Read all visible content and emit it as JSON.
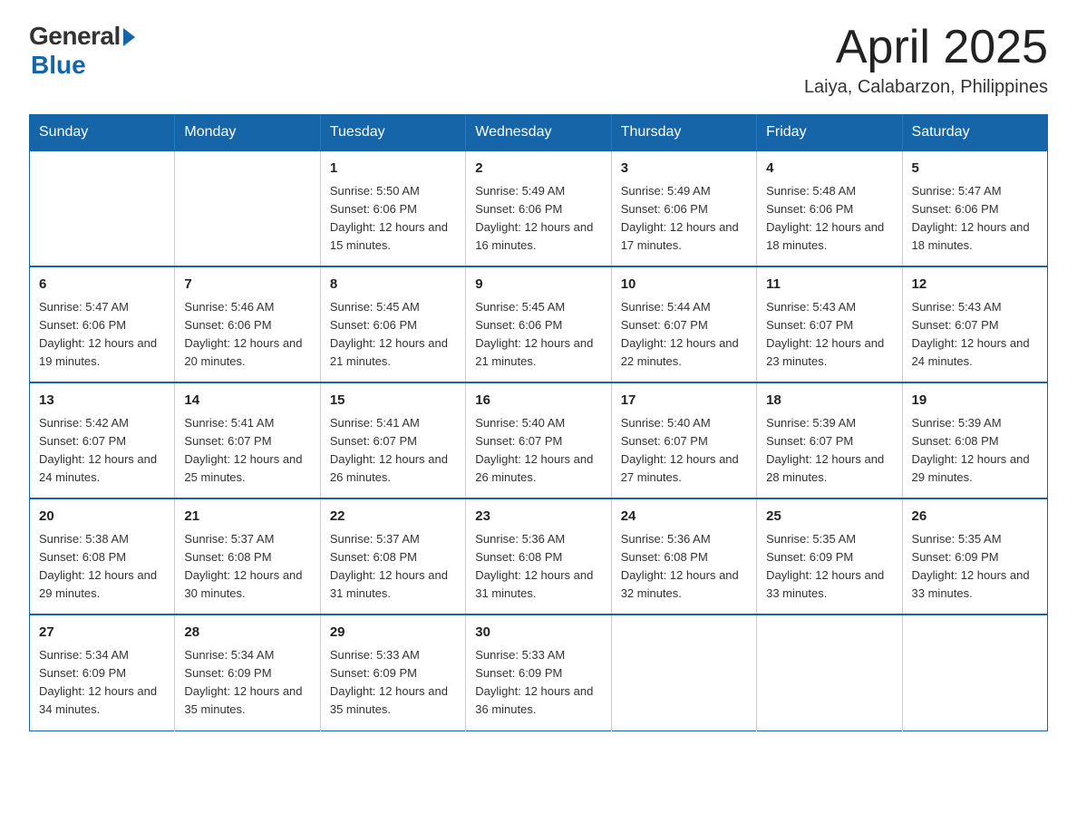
{
  "header": {
    "logo_general": "General",
    "logo_blue": "Blue",
    "month_title": "April 2025",
    "location": "Laiya, Calabarzon, Philippines"
  },
  "calendar": {
    "days_of_week": [
      "Sunday",
      "Monday",
      "Tuesday",
      "Wednesday",
      "Thursday",
      "Friday",
      "Saturday"
    ],
    "weeks": [
      [
        {
          "day": "",
          "info": ""
        },
        {
          "day": "",
          "info": ""
        },
        {
          "day": "1",
          "info": "Sunrise: 5:50 AM\nSunset: 6:06 PM\nDaylight: 12 hours\nand 15 minutes."
        },
        {
          "day": "2",
          "info": "Sunrise: 5:49 AM\nSunset: 6:06 PM\nDaylight: 12 hours\nand 16 minutes."
        },
        {
          "day": "3",
          "info": "Sunrise: 5:49 AM\nSunset: 6:06 PM\nDaylight: 12 hours\nand 17 minutes."
        },
        {
          "day": "4",
          "info": "Sunrise: 5:48 AM\nSunset: 6:06 PM\nDaylight: 12 hours\nand 18 minutes."
        },
        {
          "day": "5",
          "info": "Sunrise: 5:47 AM\nSunset: 6:06 PM\nDaylight: 12 hours\nand 18 minutes."
        }
      ],
      [
        {
          "day": "6",
          "info": "Sunrise: 5:47 AM\nSunset: 6:06 PM\nDaylight: 12 hours\nand 19 minutes."
        },
        {
          "day": "7",
          "info": "Sunrise: 5:46 AM\nSunset: 6:06 PM\nDaylight: 12 hours\nand 20 minutes."
        },
        {
          "day": "8",
          "info": "Sunrise: 5:45 AM\nSunset: 6:06 PM\nDaylight: 12 hours\nand 21 minutes."
        },
        {
          "day": "9",
          "info": "Sunrise: 5:45 AM\nSunset: 6:06 PM\nDaylight: 12 hours\nand 21 minutes."
        },
        {
          "day": "10",
          "info": "Sunrise: 5:44 AM\nSunset: 6:07 PM\nDaylight: 12 hours\nand 22 minutes."
        },
        {
          "day": "11",
          "info": "Sunrise: 5:43 AM\nSunset: 6:07 PM\nDaylight: 12 hours\nand 23 minutes."
        },
        {
          "day": "12",
          "info": "Sunrise: 5:43 AM\nSunset: 6:07 PM\nDaylight: 12 hours\nand 24 minutes."
        }
      ],
      [
        {
          "day": "13",
          "info": "Sunrise: 5:42 AM\nSunset: 6:07 PM\nDaylight: 12 hours\nand 24 minutes."
        },
        {
          "day": "14",
          "info": "Sunrise: 5:41 AM\nSunset: 6:07 PM\nDaylight: 12 hours\nand 25 minutes."
        },
        {
          "day": "15",
          "info": "Sunrise: 5:41 AM\nSunset: 6:07 PM\nDaylight: 12 hours\nand 26 minutes."
        },
        {
          "day": "16",
          "info": "Sunrise: 5:40 AM\nSunset: 6:07 PM\nDaylight: 12 hours\nand 26 minutes."
        },
        {
          "day": "17",
          "info": "Sunrise: 5:40 AM\nSunset: 6:07 PM\nDaylight: 12 hours\nand 27 minutes."
        },
        {
          "day": "18",
          "info": "Sunrise: 5:39 AM\nSunset: 6:07 PM\nDaylight: 12 hours\nand 28 minutes."
        },
        {
          "day": "19",
          "info": "Sunrise: 5:39 AM\nSunset: 6:08 PM\nDaylight: 12 hours\nand 29 minutes."
        }
      ],
      [
        {
          "day": "20",
          "info": "Sunrise: 5:38 AM\nSunset: 6:08 PM\nDaylight: 12 hours\nand 29 minutes."
        },
        {
          "day": "21",
          "info": "Sunrise: 5:37 AM\nSunset: 6:08 PM\nDaylight: 12 hours\nand 30 minutes."
        },
        {
          "day": "22",
          "info": "Sunrise: 5:37 AM\nSunset: 6:08 PM\nDaylight: 12 hours\nand 31 minutes."
        },
        {
          "day": "23",
          "info": "Sunrise: 5:36 AM\nSunset: 6:08 PM\nDaylight: 12 hours\nand 31 minutes."
        },
        {
          "day": "24",
          "info": "Sunrise: 5:36 AM\nSunset: 6:08 PM\nDaylight: 12 hours\nand 32 minutes."
        },
        {
          "day": "25",
          "info": "Sunrise: 5:35 AM\nSunset: 6:09 PM\nDaylight: 12 hours\nand 33 minutes."
        },
        {
          "day": "26",
          "info": "Sunrise: 5:35 AM\nSunset: 6:09 PM\nDaylight: 12 hours\nand 33 minutes."
        }
      ],
      [
        {
          "day": "27",
          "info": "Sunrise: 5:34 AM\nSunset: 6:09 PM\nDaylight: 12 hours\nand 34 minutes."
        },
        {
          "day": "28",
          "info": "Sunrise: 5:34 AM\nSunset: 6:09 PM\nDaylight: 12 hours\nand 35 minutes."
        },
        {
          "day": "29",
          "info": "Sunrise: 5:33 AM\nSunset: 6:09 PM\nDaylight: 12 hours\nand 35 minutes."
        },
        {
          "day": "30",
          "info": "Sunrise: 5:33 AM\nSunset: 6:09 PM\nDaylight: 12 hours\nand 36 minutes."
        },
        {
          "day": "",
          "info": ""
        },
        {
          "day": "",
          "info": ""
        },
        {
          "day": "",
          "info": ""
        }
      ]
    ]
  }
}
